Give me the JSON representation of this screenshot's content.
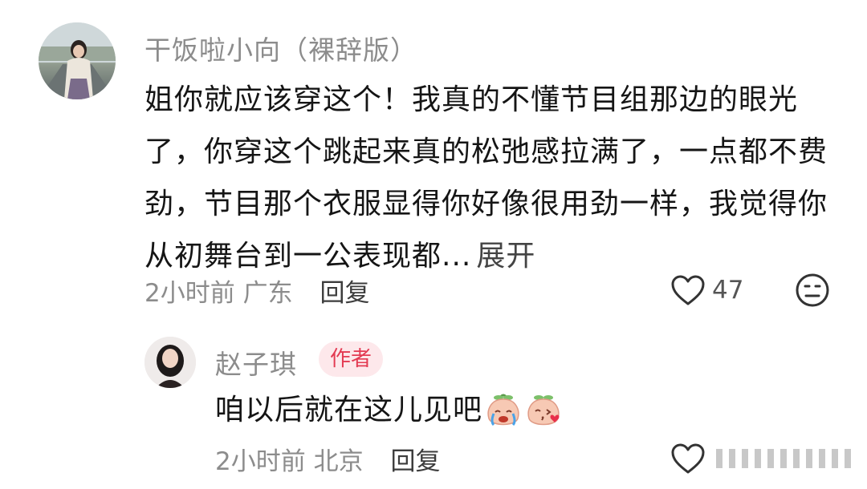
{
  "comment": {
    "username": "干饭啦小向（裸辞版）",
    "text": "姐你就应该穿这个！我真的不懂节目组那边的眼光了，你穿这个跳起来真的松弛感拉满了，一点都不费劲，节目那个衣服显得你好像很用劲一样，我觉得你从初舞台到一公表现都...",
    "expand_label": "展开",
    "time": "2小时前",
    "location": "广东",
    "reply_label": "回复",
    "like_count": "47",
    "icons": [
      "heart-icon",
      "dislike-face-icon"
    ]
  },
  "reply": {
    "username": "赵子琪",
    "badge": "作者",
    "text": "咱以后就在这儿见吧",
    "emojis": [
      "crying-peach-emoji",
      "kissing-peach-emoji"
    ],
    "time": "2小时前",
    "location": "北京",
    "reply_label": "回复",
    "icons": [
      "heart-icon"
    ]
  },
  "colors": {
    "text_primary": "#151515",
    "text_secondary": "#8c8c8c",
    "badge_bg": "#fde8eb",
    "badge_text": "#e33a52"
  }
}
